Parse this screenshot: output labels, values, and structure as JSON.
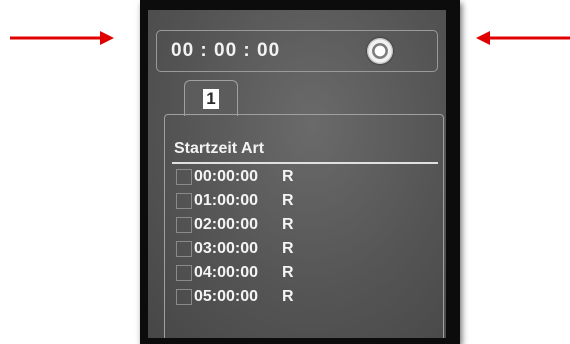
{
  "timer": {
    "display": "00 : 00 : 00"
  },
  "record_button": {
    "icon": "record-icon"
  },
  "tabs": [
    {
      "label": "1"
    }
  ],
  "list": {
    "header": "Startzeit Art",
    "rows": [
      {
        "time": "00:00:00",
        "type": "R",
        "checked": false
      },
      {
        "time": "01:00:00",
        "type": "R",
        "checked": false
      },
      {
        "time": "02:00:00",
        "type": "R",
        "checked": false
      },
      {
        "time": "03:00:00",
        "type": "R",
        "checked": false
      },
      {
        "time": "04:00:00",
        "type": "R",
        "checked": false
      },
      {
        "time": "05:00:00",
        "type": "R",
        "checked": false
      }
    ]
  },
  "annotations": {
    "arrow_color": "#e00000"
  }
}
